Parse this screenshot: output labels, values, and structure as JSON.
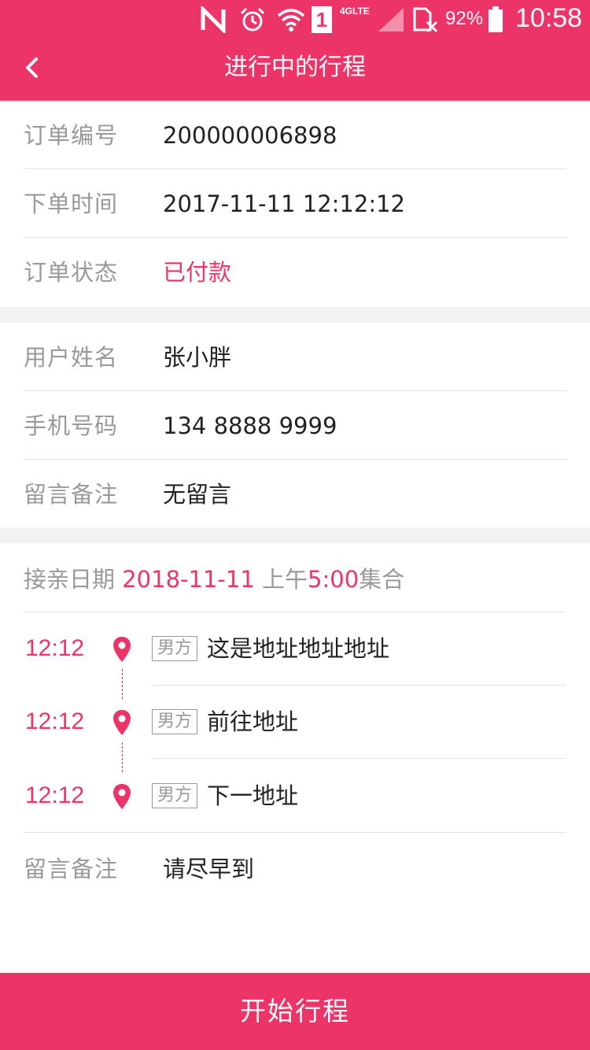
{
  "status_bar": {
    "network_label": "4GLTE",
    "sim_slot": "1",
    "battery": "92%",
    "time": "10:58",
    "icons": [
      "nfc-icon",
      "alarm-icon",
      "wifi-icon",
      "sim-1-icon",
      "signal-icon",
      "no-sim-icon",
      "battery-icon"
    ]
  },
  "nav": {
    "title": "进行中的行程",
    "back_icon": "chevron-left-icon"
  },
  "order": {
    "number_label": "订单编号",
    "number_value": "200000006898",
    "time_label": "下单时间",
    "time_value": "2017-11-11 12:12:12",
    "status_label": "订单状态",
    "status_value": "已付款"
  },
  "user": {
    "name_label": "用户姓名",
    "name_value": "张小胖",
    "phone_label": "手机号码",
    "phone_value": "134 8888 9999",
    "note_label": "留言备注",
    "note_value": "无留言"
  },
  "trip": {
    "date_label": "接亲日期",
    "date_value": "2018-11-11",
    "period": "上午",
    "hour": "5:00",
    "gather": "集合",
    "stops": [
      {
        "time": "12:12",
        "tag": "男方",
        "address": "这是地址地址地址"
      },
      {
        "time": "12:12",
        "tag": "男方",
        "address": "前往地址"
      },
      {
        "time": "12:12",
        "tag": "男方",
        "address": "下一地址"
      }
    ],
    "note_label": "留言备注",
    "note_value": "请尽早到"
  },
  "actions": {
    "start_label": "开始行程"
  },
  "colors": {
    "accent": "#ec3469",
    "label": "#999999",
    "divider": "#e3e3e3",
    "gap": "#f2f2f2"
  }
}
